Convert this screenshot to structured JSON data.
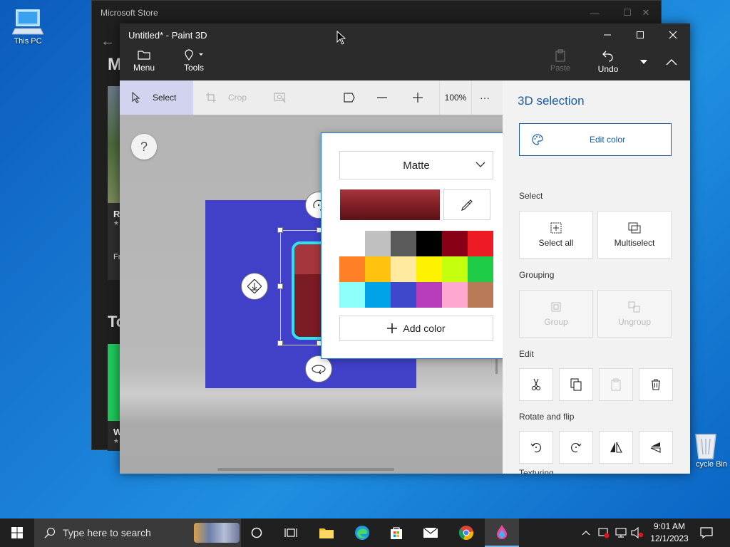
{
  "desktop": {
    "this_pc_label": "This PC",
    "recycle_bin_label": "cycle Bin"
  },
  "store": {
    "title": "Microsoft Store",
    "partial_headings": [
      "M",
      "To"
    ],
    "partial_card_labels": [
      "R",
      "Fr",
      "W"
    ]
  },
  "paint": {
    "title": "Untitled* - Paint 3D",
    "menu_label": "Menu",
    "tools_label": "Tools",
    "paste_label": "Paste",
    "undo_label": "Undo",
    "toolbar": {
      "select_label": "Select",
      "crop_label": "Crop",
      "zoom_value": "100%",
      "more_label": "···"
    },
    "canvas": {
      "help_label": "?"
    }
  },
  "color_popup": {
    "finish": "Matte",
    "current_color": "#7a1c22",
    "palette": [
      "#ffffff",
      "#c0c0c0",
      "#5a5a5a",
      "#000000",
      "#880015",
      "#ed1c24",
      "#ff7f27",
      "#ffc20e",
      "#ffeaa0",
      "#fff200",
      "#c4ff0e",
      "#1fcc48",
      "#8cfffb",
      "#00a2e8",
      "#3f48cc",
      "#b83dba",
      "#ffa8cf",
      "#b97a57"
    ],
    "add_color_label": "Add color"
  },
  "panel": {
    "title": "3D selection",
    "edit_color_label": "Edit color",
    "select_heading": "Select",
    "select_all_label": "Select all",
    "multiselect_label": "Multiselect",
    "grouping_heading": "Grouping",
    "group_label": "Group",
    "ungroup_label": "Ungroup",
    "edit_heading": "Edit",
    "rotate_heading": "Rotate and flip",
    "texturing_heading": "Texturing"
  },
  "taskbar": {
    "search_placeholder": "Type here to search",
    "time": "9:01 AM",
    "date": "12/1/2023"
  },
  "colors": {
    "accent": "#1a5ca3",
    "canvas_blue": "#4040c9",
    "selection_cyan": "#2ee3ee"
  }
}
